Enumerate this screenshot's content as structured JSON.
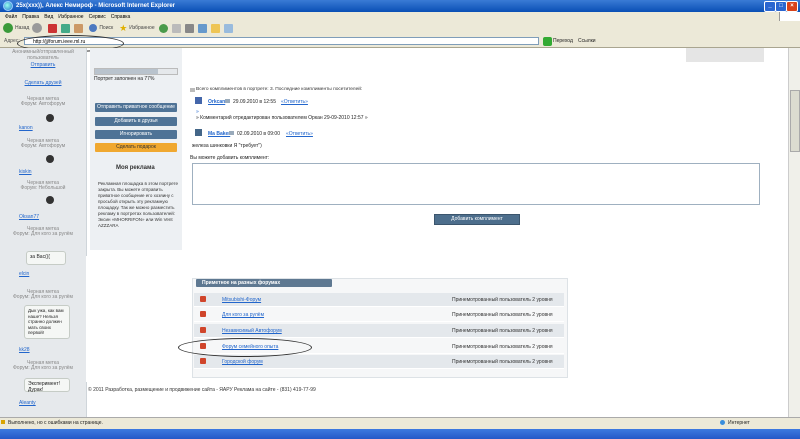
{
  "window": {
    "title": "25x(xxx)), Алекс Немироф - Microsoft Internet Explorer"
  },
  "menu": [
    "Файл",
    "Правка",
    "Вид",
    "Избранное",
    "Сервис",
    "Справка"
  ],
  "toolbar": {
    "back": "Назад",
    "search": "Поиск",
    "favorites": "Избранное"
  },
  "address": {
    "label": "Адрес:",
    "url": "http://jj/forum.ieee.ml.ru",
    "go": "Переход",
    "links": "Ссылки"
  },
  "sidebar": {
    "top_text": "Анонимный/отправленный пользователь",
    "top_link": "Отправить",
    "make_friend": "Сделать друзей",
    "entries": [
      {
        "line1": "Черная метка",
        "line2": "Форум: Автофорум",
        "user": "kanon"
      },
      {
        "line1": "Черная метка",
        "line2": "Форум: Автофорум",
        "user": "kiskin"
      },
      {
        "line1": "Черная метка",
        "line2": "Форум: Небольшой",
        "user": "Oksan77"
      },
      {
        "line1": "Черная метка",
        "line2": "Форум: Для кого за рулём",
        "bubble": "за Вас(((",
        "user": "elcin"
      },
      {
        "line1": "Черная метка",
        "line2": "Форум: Для кого за рулём",
        "bubble": "Дык ужа, как вам наше? Нельзя странно должен мать своих первой!",
        "user": "kk28"
      },
      {
        "line1": "Черная метка",
        "line2": "Форум: Для кого за рулём",
        "bubble": "Эксперимент! Дурак!",
        "user": "Aleanty"
      }
    ]
  },
  "profile": {
    "progress_label": "Портрет заполнен на 77%",
    "progress": 0.77,
    "buttons": [
      "Отправить приватное сообщение",
      "Добавить в друзья",
      "Игнорировать",
      "Сделать подарок"
    ],
    "ad_title": "Моя реклама",
    "ad_text": "Рекламная площадка в этом портрете закрыта. Вы можете отправить приватное сообщение его хозяину с просьбой открыть эту рекламную площадку. Так же можно разместить рекламу в портретах пользователей: Эксин «MHORRIFON» или Win Vent AZZZARA"
  },
  "compliments": {
    "header": "Всего комплиментов в портрете: 3. Последние комплименты посетителей:",
    "items": [
      {
        "user": "Orkcan",
        "date": "29.09.2010 в 12:55",
        "reply": "«Ответить»",
        "text": ""
      },
      {
        "user": "",
        "date": "",
        "reply": "",
        "text": "» Комментарий отредактирован пользователем Оркан 29-09-2010 12:57 »"
      },
      {
        "user": "Ma Baker",
        "date": "02.09.2010 в 09:00",
        "reply": "«Ответить»",
        "text": "железа шинковки Я \"требует\")"
      }
    ],
    "prompt": "Вы можете добавить комплимент:",
    "submit": "Добавить комплимент"
  },
  "forums": {
    "header": "Приметное на разных форумах",
    "rows": [
      {
        "name": "Mitsubishi-Форум",
        "status": "Принемотрованный пользователь 2 уровня"
      },
      {
        "name": "Для кого за рулём",
        "status": "Принемотрованный пользователь 2 уровня"
      },
      {
        "name": "Независимый Автофорум",
        "status": "Принемотрованный пользователь 2 уровня"
      },
      {
        "name": "Форум семейного опыта",
        "status": "Принемотрованный пользователь 2 уровня"
      },
      {
        "name": "Городской форум",
        "status": "Принемотрованный пользователь 2 уровня"
      }
    ]
  },
  "footer": "© 2011 Разработка, размещение и продвижение сайта - ЯАРУ   Реклама на сайте - (831) 419-77-99",
  "status": {
    "text": "Выполнено, но с ошибками на странице.",
    "zone": "Интернет"
  },
  "colors": {
    "btn_blue": "#4f7396",
    "btn_orange": "#f0a830",
    "header_blue": "#5e7891"
  }
}
